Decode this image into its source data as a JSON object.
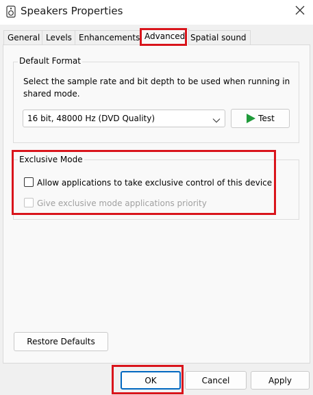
{
  "window": {
    "title": "Speakers Properties",
    "app_icon": "speaker-icon",
    "close_icon": "close-icon"
  },
  "tabs": [
    {
      "label": "General",
      "active": false
    },
    {
      "label": "Levels",
      "active": false
    },
    {
      "label": "Enhancements",
      "active": false
    },
    {
      "label": "Advanced",
      "active": true
    },
    {
      "label": "Spatial sound",
      "active": false
    }
  ],
  "default_format": {
    "label": "Default Format",
    "description_line1": "Select the sample rate and bit depth to be used when running in",
    "description_line2": "shared mode.",
    "selected_format": "16 bit, 48000 Hz (DVD Quality)",
    "test_label": "Test",
    "test_icon": "play-icon"
  },
  "exclusive_mode": {
    "label": "Exclusive Mode",
    "allow_label": "Allow applications to take exclusive control of this device",
    "allow_checked": false,
    "priority_label": "Give exclusive mode applications priority",
    "priority_checked": false,
    "priority_enabled": false
  },
  "buttons": {
    "restore_defaults": "Restore Defaults",
    "ok": "OK",
    "cancel": "Cancel",
    "apply": "Apply"
  },
  "colors": {
    "highlight": "#d9141b",
    "play_green": "#1f9a3a"
  }
}
